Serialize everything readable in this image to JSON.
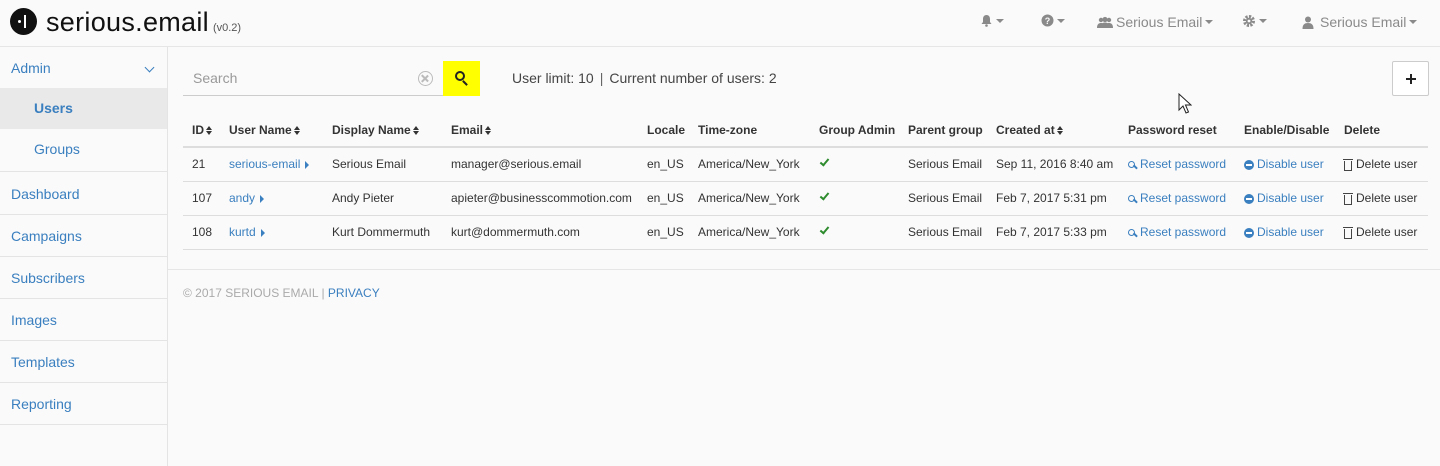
{
  "brand": {
    "name": "serious.email",
    "version": "(v0.2)"
  },
  "topnav": {
    "account_group": "Serious Email",
    "user": "Serious Email"
  },
  "sidebar": {
    "admin": "Admin",
    "sub_items": [
      {
        "label": "Users",
        "active": true
      },
      {
        "label": "Groups",
        "active": false
      }
    ],
    "items": [
      {
        "label": "Dashboard"
      },
      {
        "label": "Campaigns"
      },
      {
        "label": "Subscribers"
      },
      {
        "label": "Images"
      },
      {
        "label": "Templates"
      },
      {
        "label": "Reporting"
      }
    ]
  },
  "search": {
    "placeholder": "Search",
    "value": ""
  },
  "limits": {
    "user_limit": "User limit: 10",
    "current": "Current number of users: 2",
    "separator": "|"
  },
  "table": {
    "columns": [
      "ID",
      "User Name",
      "Display Name",
      "Email",
      "Locale",
      "Time-zone",
      "Group Admin",
      "Parent group",
      "Created at",
      "Password reset",
      "Enable/Disable",
      "Delete"
    ],
    "rows": [
      {
        "id": "21",
        "username": "serious-email",
        "display": "Serious Email",
        "email": "manager@serious.email",
        "locale": "en_US",
        "tz": "America/New_York",
        "group_admin": true,
        "parent": "Serious Email",
        "created": "Sep 11, 2016 8:40 am",
        "reset": "Reset password",
        "enable": "Disable user",
        "delete": "Delete user"
      },
      {
        "id": "107",
        "username": "andy",
        "display": "Andy Pieter",
        "email": "apieter@businesscommotion.com",
        "locale": "en_US",
        "tz": "America/New_York",
        "group_admin": true,
        "parent": "Serious Email",
        "created": "Feb 7, 2017 5:31 pm",
        "reset": "Reset password",
        "enable": "Disable user",
        "delete": "Delete user"
      },
      {
        "id": "108",
        "username": "kurtd",
        "display": "Kurt Dommermuth",
        "email": "kurt@dommermuth.com",
        "locale": "en_US",
        "tz": "America/New_York",
        "group_admin": true,
        "parent": "Serious Email",
        "created": "Feb 7, 2017 5:33 pm",
        "reset": "Reset password",
        "enable": "Disable user",
        "delete": "Delete user"
      }
    ]
  },
  "footer": {
    "copyright": "© 2017 SERIOUS EMAIL |",
    "privacy": "PRIVACY"
  },
  "colors": {
    "accent": "#3a7fbf",
    "search_button": "#ffff00",
    "check": "#2e8b2e"
  },
  "icons": [
    "bell-icon",
    "question-icon",
    "users-icon",
    "gear-icon",
    "user-icon",
    "search-icon",
    "clear-icon",
    "plus-icon",
    "key-icon",
    "minus-circle-icon",
    "trash-icon",
    "check-icon"
  ]
}
